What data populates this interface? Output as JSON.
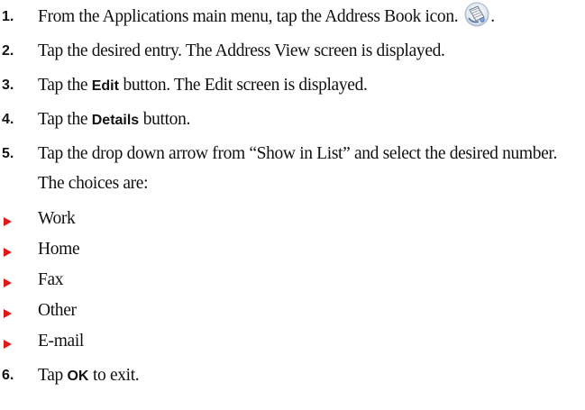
{
  "steps": [
    {
      "number": "1.",
      "text_before": "From the Applications main menu, tap the Address Book icon.",
      "icon": "address-book-icon",
      "text_after": "."
    },
    {
      "number": "2.",
      "text": "Tap the desired entry. The Address View screen is displayed."
    },
    {
      "number": "3.",
      "pre": "Tap the",
      "bold": "Edit",
      "post": "button. The Edit screen is displayed."
    },
    {
      "number": "4.",
      "pre": "Tap the",
      "bold": "Details",
      "post": "button."
    },
    {
      "number": "5.",
      "text": "Tap the drop down arrow from “Show in List” and select the desired number. The choices are:"
    },
    {
      "number": "6.",
      "pre": "Tap",
      "bold": "OK",
      "post": "to exit."
    }
  ],
  "choices": [
    "Work",
    "Home",
    "Fax",
    "Other",
    "E-mail"
  ],
  "colors": {
    "bullet_arrow": "#e01818",
    "text": "#111111"
  }
}
